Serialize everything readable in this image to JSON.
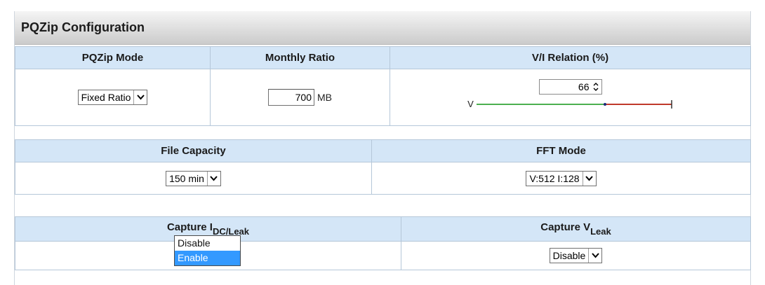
{
  "panel": {
    "title": "PQZip Configuration"
  },
  "row1": {
    "mode_header": "PQZip Mode",
    "mode_value": "Fixed Ratio",
    "ratio_header": "Monthly Ratio",
    "ratio_value": "700",
    "ratio_unit": "MB",
    "vi_header": "V/I Relation (%)",
    "vi_value": "66",
    "vi_left_label": "V",
    "vi_level_percent": 66
  },
  "row2": {
    "capacity_header": "File Capacity",
    "capacity_value": "150 min",
    "fft_header": "FFT Mode",
    "fft_value": "V:512 I:128"
  },
  "row3": {
    "capture_i_header": "Capture I",
    "capture_i_sub": "DC/Leak",
    "capture_v_header": "Capture V",
    "capture_v_sub": "Leak",
    "capture_v_value": "Disable",
    "dropdown_options": [
      "Disable",
      "Enable"
    ],
    "dropdown_highlighted": "Enable"
  },
  "colors": {
    "header_blue": "#d4e6f7",
    "slider_green": "#4caf50",
    "slider_red": "#c0392b",
    "highlight": "#3399ff"
  }
}
